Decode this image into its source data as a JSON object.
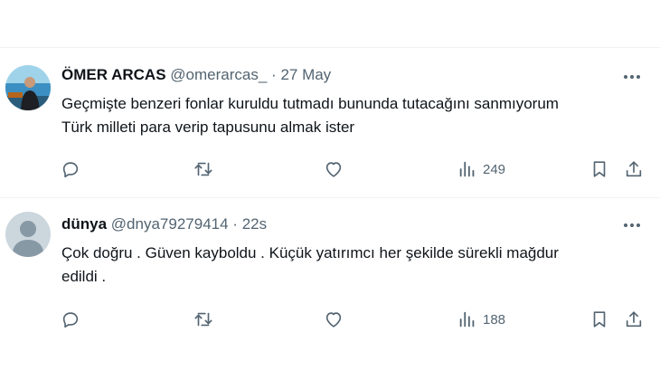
{
  "tweets": [
    {
      "name": "ÖMER ARCAS",
      "handle": "@omerarcas_",
      "separator": "·",
      "time": "27 May",
      "text": "Geçmişte benzeri fonlar kuruldu tutmadı bununda tutacağını sanmıyorum\nTürk milleti para verip tapusunu almak ister",
      "views": "249"
    },
    {
      "name": "dünya",
      "handle": "@dnya79279414",
      "separator": "·",
      "time": "22s",
      "text": "Çok doğru . Güven kayboldu . Küçük yatırımcı her şekilde sürekli mağdur\nedildi .",
      "views": "188"
    }
  ],
  "icons": {
    "reply": "reply-icon",
    "retweet": "retweet-icon",
    "like": "like-icon",
    "views": "views-icon",
    "bookmark": "bookmark-icon",
    "share": "share-icon",
    "more": "more-icon"
  },
  "colors": {
    "text": "#0f1419",
    "secondary": "#536471",
    "divider": "#eff3f4"
  }
}
